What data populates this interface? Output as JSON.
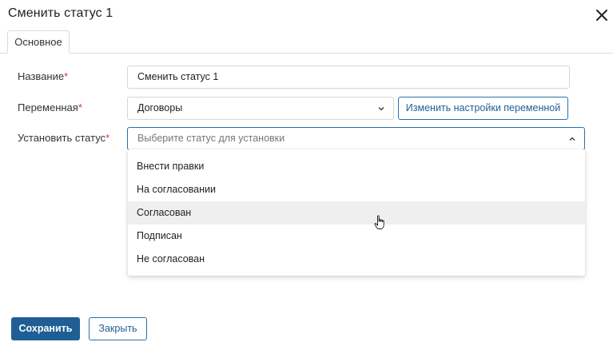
{
  "dialog": {
    "title": "Сменить статус 1",
    "close_icon": "close-icon"
  },
  "tabs": [
    {
      "label": "Основное",
      "active": true
    }
  ],
  "form": {
    "name": {
      "label": "Название",
      "required_mark": "*",
      "value": "Сменить статус 1"
    },
    "variable": {
      "label": "Переменная",
      "required_mark": "*",
      "value": "Договоры",
      "button_label": "Изменить настройки переменной"
    },
    "set_status": {
      "label": "Установить статус",
      "required_mark": "*",
      "placeholder": "Выберите статус для установки",
      "options": [
        "Внести правки",
        "На согласовании",
        "Согласован",
        "Подписан",
        "Не согласован"
      ],
      "hovered_option": "Согласован"
    }
  },
  "footer": {
    "save_label": "Сохранить",
    "close_label": "Закрыть"
  },
  "colors": {
    "accent": "#1f5f96",
    "required": "#d9363e",
    "hover": "#efefef"
  }
}
